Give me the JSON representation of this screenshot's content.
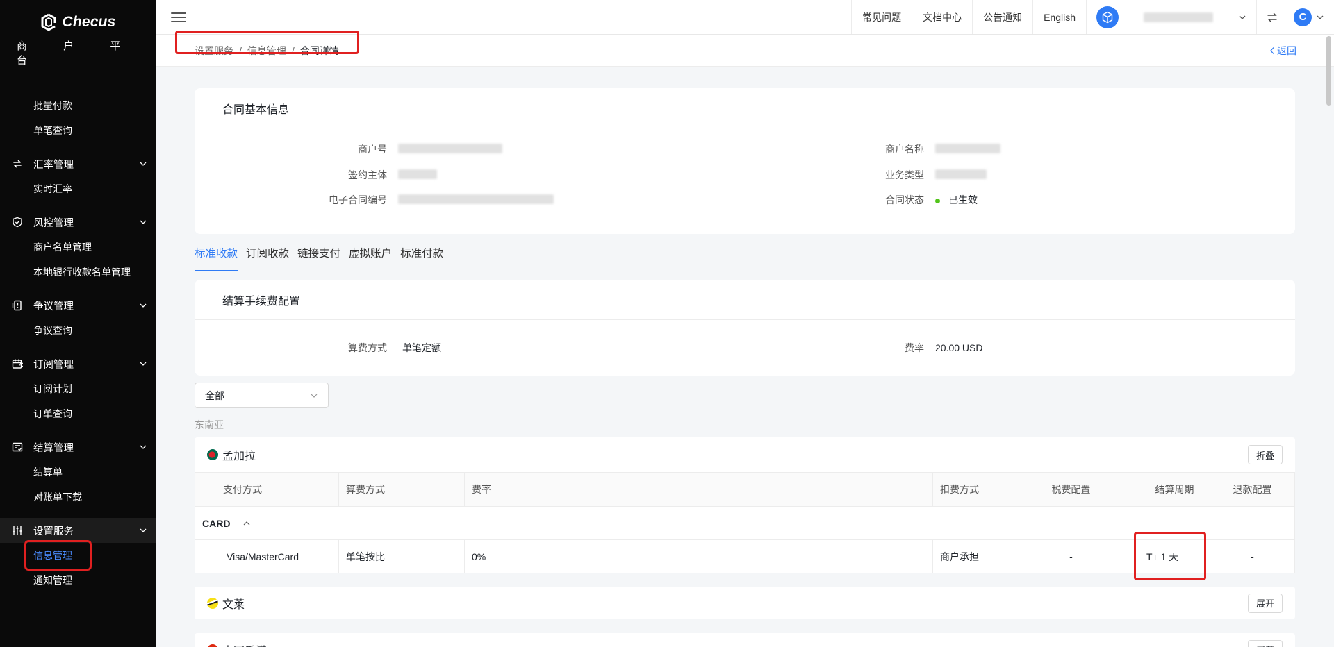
{
  "sidebar": {
    "logo_text": "Checus",
    "logo_sub": "商 户 平 台",
    "items": [
      {
        "type": "sub",
        "label": "批量付款"
      },
      {
        "type": "sub",
        "label": "单笔查询"
      },
      {
        "type": "group",
        "label": "汇率管理",
        "icon": "exchange-icon"
      },
      {
        "type": "sub",
        "label": "实时汇率"
      },
      {
        "type": "group",
        "label": "风控管理",
        "icon": "shield-check-icon"
      },
      {
        "type": "sub",
        "label": "商户名单管理"
      },
      {
        "type": "sub",
        "label": "本地银行收款名单管理"
      },
      {
        "type": "group",
        "label": "争议管理",
        "icon": "phone-dispute-icon"
      },
      {
        "type": "sub",
        "label": "争议查询"
      },
      {
        "type": "group",
        "label": "订阅管理",
        "icon": "calendar-icon"
      },
      {
        "type": "sub",
        "label": "订阅计划"
      },
      {
        "type": "sub",
        "label": "订单查询"
      },
      {
        "type": "group",
        "label": "结算管理",
        "icon": "settlement-icon"
      },
      {
        "type": "sub",
        "label": "结算单"
      },
      {
        "type": "sub",
        "label": "对账单下载"
      },
      {
        "type": "group",
        "label": "设置服务",
        "icon": "sliders-icon"
      },
      {
        "type": "sub",
        "label": "信息管理"
      },
      {
        "type": "sub",
        "label": "通知管理"
      }
    ]
  },
  "topbar": {
    "faq": "常见问题",
    "docs": "文档中心",
    "notice": "公告通知",
    "language": "English",
    "avatar_letter": "C"
  },
  "breadcrumb": {
    "items": [
      "设置服务",
      "信息管理",
      "合同详情"
    ],
    "separator": "/",
    "back": "返回"
  },
  "contract": {
    "title": "合同基本信息",
    "merchant_no_label": "商户号",
    "signing_entity_label": "签约主体",
    "econtract_no_label": "电子合同编号",
    "merchant_name_label": "商户名称",
    "business_type_label": "业务类型",
    "status_label": "合同状态",
    "status_value": "已生效"
  },
  "tabs": [
    "标准收款",
    "订阅收款",
    "链接支付",
    "虚拟账户",
    "标准付款"
  ],
  "settlement_fee": {
    "title": "结算手续费配置",
    "method_label": "算费方式",
    "method_value": "单笔定额",
    "rate_label": "费率",
    "rate_value": "20.00 USD"
  },
  "filter": {
    "selected": "全部"
  },
  "region": "东南亚",
  "countries": [
    {
      "name": "孟加拉",
      "button": "折叠"
    },
    {
      "name": "文莱",
      "button": "展开"
    },
    {
      "name": "中国香港",
      "button": "展开"
    }
  ],
  "fee_table": {
    "headers": [
      "支付方式",
      "算费方式",
      "费率",
      "扣费方式",
      "税费配置",
      "结算周期",
      "退款配置"
    ],
    "group": "CARD",
    "row": [
      "Visa/MasterCard",
      "单笔按比",
      "0%",
      "商户承担",
      "-",
      "T+ 1 天",
      "-"
    ]
  },
  "colors": {
    "accent": "#2f7bf5",
    "highlight": "#e02020",
    "status_active": "#52c41a",
    "sidebar_bg": "#0a0a0a"
  }
}
